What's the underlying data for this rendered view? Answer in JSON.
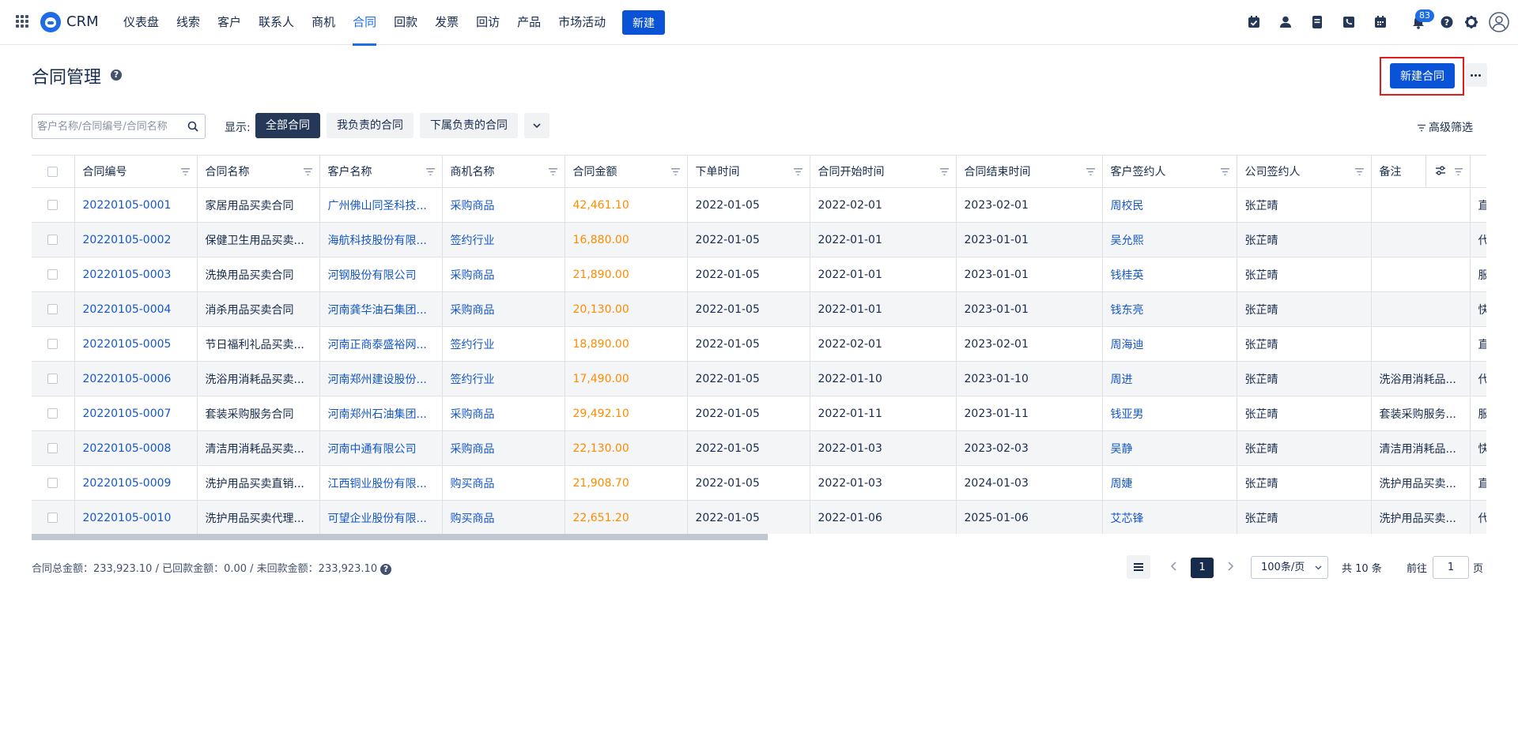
{
  "app": {
    "name": "CRM",
    "logo_icon": "crm-logo-icon"
  },
  "nav": {
    "items": [
      {
        "label": "仪表盘"
      },
      {
        "label": "线索"
      },
      {
        "label": "客户"
      },
      {
        "label": "联系人"
      },
      {
        "label": "商机"
      },
      {
        "label": "合同",
        "active": true
      },
      {
        "label": "回款"
      },
      {
        "label": "发票"
      },
      {
        "label": "回访"
      },
      {
        "label": "产品"
      },
      {
        "label": "市场活动"
      }
    ],
    "new_label": "新建"
  },
  "toolbar_icons": [
    "task-check-icon",
    "user-icon",
    "document-icon",
    "phone-icon",
    "calendar-icon",
    "bell-icon",
    "help-icon",
    "gear-icon",
    "avatar-icon"
  ],
  "notifications": {
    "count": "83"
  },
  "page": {
    "title": "合同管理",
    "new_button": "新建合同"
  },
  "filters": {
    "search_placeholder": "客户名称/合同编号/合同名称",
    "show_label": "显示:",
    "segments": [
      {
        "label": "全部合同",
        "active": true
      },
      {
        "label": "我负责的合同"
      },
      {
        "label": "下属负责的合同"
      }
    ],
    "advanced": "高级筛选"
  },
  "table": {
    "columns": [
      "合同编号",
      "合同名称",
      "客户名称",
      "商机名称",
      "合同金额",
      "下单时间",
      "合同开始时间",
      "合同结束时间",
      "客户签约人",
      "公司签约人",
      "备注"
    ],
    "rows": [
      {
        "no": "20220105-0001",
        "name": "家居用品买卖合同",
        "customer": "广州佛山同圣科技...",
        "opportunity": "采购商品",
        "amount": "42,461.10",
        "order_date": "2022-01-05",
        "start": "2022-02-01",
        "end": "2023-02-01",
        "customer_signer": "周校民",
        "company_signer": "张芷晴",
        "remark": "",
        "extra": "直"
      },
      {
        "no": "20220105-0002",
        "name": "保健卫生用品买卖...",
        "customer": "海航科技股份有限...",
        "opportunity": "签约行业",
        "amount": "16,880.00",
        "order_date": "2022-01-05",
        "start": "2022-01-01",
        "end": "2023-01-01",
        "customer_signer": "吴允熙",
        "company_signer": "张芷晴",
        "remark": "",
        "extra": "代"
      },
      {
        "no": "20220105-0003",
        "name": "洗换用品买卖合同",
        "customer": "河钢股份有限公司",
        "opportunity": "采购商品",
        "amount": "21,890.00",
        "order_date": "2022-01-05",
        "start": "2022-01-01",
        "end": "2023-01-01",
        "customer_signer": "钱桂英",
        "company_signer": "张芷晴",
        "remark": "",
        "extra": "服"
      },
      {
        "no": "20220105-0004",
        "name": "消杀用品买卖合同",
        "customer": "河南龚华油石集团...",
        "opportunity": "采购商品",
        "amount": "20,130.00",
        "order_date": "2022-01-05",
        "start": "2022-01-01",
        "end": "2023-01-01",
        "customer_signer": "钱东亮",
        "company_signer": "张芷晴",
        "remark": "",
        "extra": "快"
      },
      {
        "no": "20220105-0005",
        "name": "节日福利礼品买卖...",
        "customer": "河南正商泰盛裕网...",
        "opportunity": "签约行业",
        "amount": "18,890.00",
        "order_date": "2022-01-05",
        "start": "2022-02-01",
        "end": "2023-02-01",
        "customer_signer": "周海迪",
        "company_signer": "张芷晴",
        "remark": "",
        "extra": "直"
      },
      {
        "no": "20220105-0006",
        "name": "洗浴用消耗品买卖...",
        "customer": "河南郑州建设股份...",
        "opportunity": "签约行业",
        "amount": "17,490.00",
        "order_date": "2022-01-05",
        "start": "2022-01-10",
        "end": "2023-01-10",
        "customer_signer": "周进",
        "company_signer": "张芷晴",
        "remark": "洗浴用消耗品...",
        "extra": "代"
      },
      {
        "no": "20220105-0007",
        "name": "套装采购服务合同",
        "customer": "河南郑州石油集团...",
        "opportunity": "采购商品",
        "amount": "29,492.10",
        "order_date": "2022-01-05",
        "start": "2022-01-11",
        "end": "2023-01-11",
        "customer_signer": "钱亚男",
        "company_signer": "张芷晴",
        "remark": "套装采购服务...",
        "extra": "服"
      },
      {
        "no": "20220105-0008",
        "name": "清洁用消耗品买卖...",
        "customer": "河南中通有限公司",
        "opportunity": "采购商品",
        "amount": "22,130.00",
        "order_date": "2022-01-05",
        "start": "2022-01-03",
        "end": "2023-02-03",
        "customer_signer": "吴静",
        "company_signer": "张芷晴",
        "remark": "清洁用消耗品...",
        "extra": "快"
      },
      {
        "no": "20220105-0009",
        "name": "洗护用品买卖直销...",
        "customer": "江西铜业股份有限...",
        "opportunity": "购买商品",
        "amount": "21,908.70",
        "order_date": "2022-01-05",
        "start": "2022-01-03",
        "end": "2024-01-03",
        "customer_signer": "周婕",
        "company_signer": "张芷晴",
        "remark": "洗护用品买卖...",
        "extra": "直"
      },
      {
        "no": "20220105-0010",
        "name": "洗护用品买卖代理...",
        "customer": "可望企业股份有限...",
        "opportunity": "购买商品",
        "amount": "22,651.20",
        "order_date": "2022-01-05",
        "start": "2022-01-06",
        "end": "2025-01-06",
        "customer_signer": "艾芯锋",
        "company_signer": "张芷晴",
        "remark": "洗护用品买卖...",
        "extra": "代"
      }
    ]
  },
  "footer": {
    "summary": "合同总金额：233,923.10 / 已回款金额：0.00 / 未回款金额：233,923.10",
    "current_page": "1",
    "page_size": "100条/页",
    "total": "共 10 条",
    "goto_label": "前往",
    "goto_value": "1",
    "page_unit": "页"
  },
  "colors": {
    "primary": "#0a52d6",
    "link": "#1557c8",
    "amount": "#ff8b00",
    "dark": "#172b4d",
    "highlight_border": "#e31b1b"
  }
}
